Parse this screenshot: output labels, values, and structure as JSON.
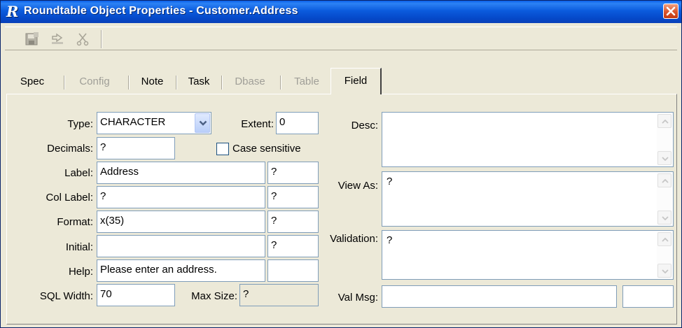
{
  "window": {
    "app_icon": "R",
    "title": "Roundtable Object Properties - Customer.Address",
    "close_icon": "close-icon"
  },
  "toolbar": {
    "buttons": [
      {
        "icon": "save-icon",
        "enabled": false
      },
      {
        "icon": "undo-icon",
        "enabled": false
      },
      {
        "icon": "cut-icon",
        "enabled": false
      }
    ]
  },
  "tabs": [
    {
      "label": "Spec",
      "enabled": true
    },
    {
      "label": "Config",
      "enabled": false
    },
    {
      "label": "Note",
      "enabled": true
    },
    {
      "label": "Task",
      "enabled": true
    },
    {
      "label": "Dbase",
      "enabled": false
    },
    {
      "label": "Table",
      "enabled": false
    },
    {
      "label": "Field",
      "enabled": true,
      "active": true
    }
  ],
  "field": {
    "type_label": "Type:",
    "type_value": "CHARACTER",
    "extent_label": "Extent:",
    "extent_value": "0",
    "decimals_label": "Decimals:",
    "decimals_value": "?",
    "case_sensitive_label": "Case sensitive",
    "case_sensitive_checked": false,
    "label_label": "Label:",
    "label_value": "Address",
    "label_sa": "?",
    "col_label_label": "Col Label:",
    "col_label_value": "?",
    "col_label_sa": "?",
    "format_label": "Format:",
    "format_value": "x(35)",
    "format_sa": "?",
    "initial_label": "Initial:",
    "initial_value": "",
    "initial_sa": "?",
    "help_label": "Help:",
    "help_value": "Please enter an address.",
    "help_sa": "",
    "sql_width_label": "SQL Width:",
    "sql_width_value": "70",
    "max_size_label": "Max Size:",
    "max_size_value": "?",
    "desc_label": "Desc:",
    "desc_value": "",
    "view_as_label": "View As:",
    "view_as_value": "?",
    "validation_label": "Validation:",
    "validation_value": "?",
    "val_msg_label": "Val Msg:",
    "val_msg_value": "",
    "val_msg_sa": ""
  }
}
